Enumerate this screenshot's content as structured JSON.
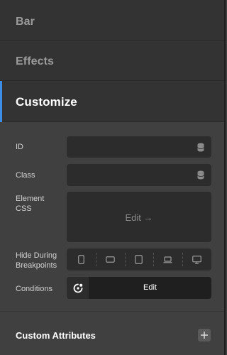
{
  "accordion": {
    "bar_label": "Bar",
    "effects_label": "Effects",
    "customize_label": "Customize"
  },
  "fields": {
    "id_label": "ID",
    "class_label": "Class",
    "element_css_label_line1": "Element",
    "element_css_label_line2": "CSS",
    "element_css_edit": "Edit →",
    "hide_label_line1": "Hide During",
    "hide_label_line2": "Breakpoints",
    "conditions_label": "Conditions",
    "conditions_edit": "Edit"
  },
  "breakpoints": [
    {
      "icon": "phone-portrait-icon"
    },
    {
      "icon": "phone-landscape-icon"
    },
    {
      "icon": "tablet-icon"
    },
    {
      "icon": "laptop-icon"
    },
    {
      "icon": "desktop-icon"
    }
  ],
  "custom_attributes": {
    "label": "Custom Attributes"
  },
  "colors": {
    "accent": "#3d8ee6",
    "panel": "#404040",
    "header": "#333333",
    "field": "#2c2c2c"
  }
}
